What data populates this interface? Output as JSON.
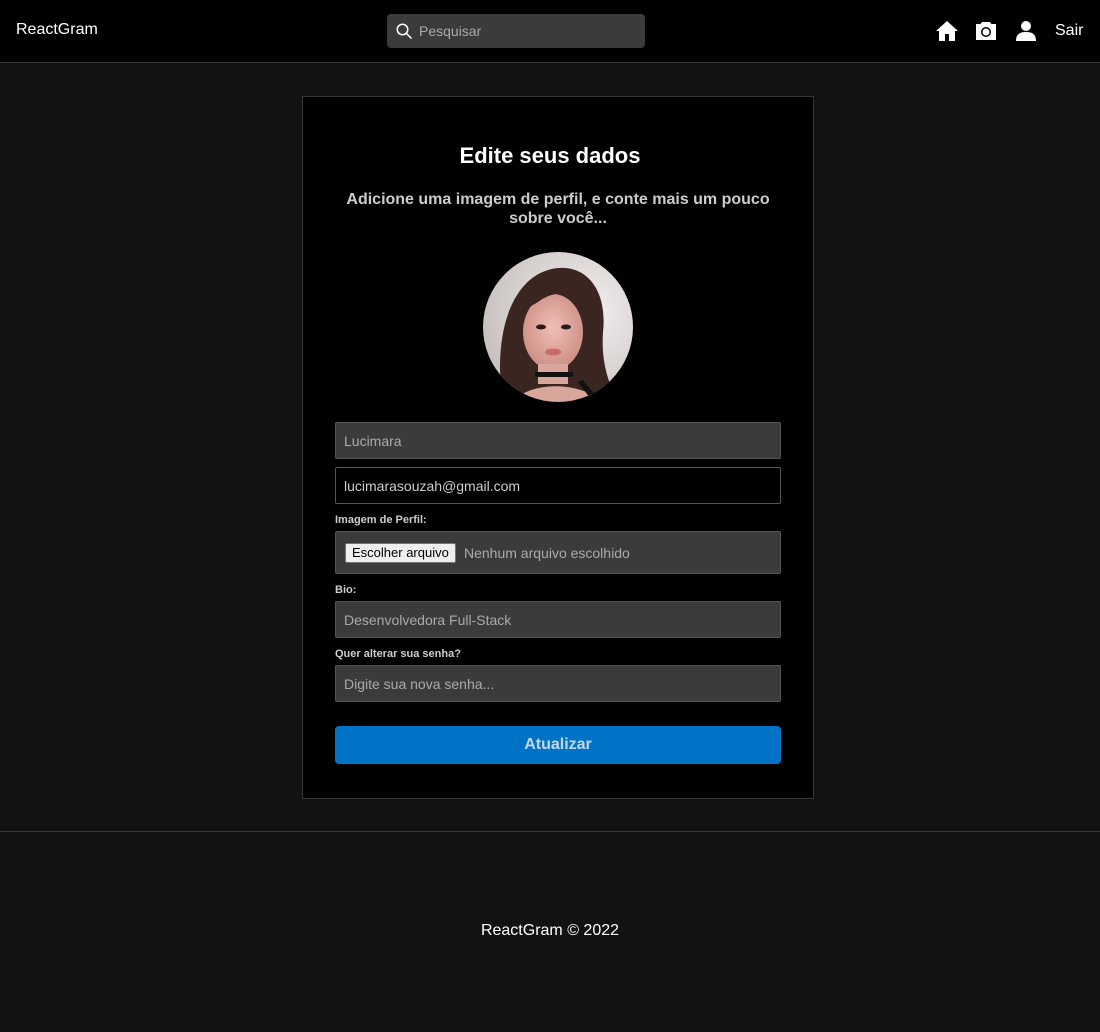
{
  "navbar": {
    "brand": "ReactGram",
    "search_placeholder": "Pesquisar",
    "icons": [
      "home-icon",
      "camera-icon",
      "user-icon"
    ],
    "logout_label": "Sair"
  },
  "form": {
    "title": "Edite seus dados",
    "subtitle": "Adicione uma imagem de perfil, e conte mais um pouco sobre você...",
    "name_value": "Lucimara",
    "email_value": "lucimarasouzah@gmail.com",
    "image_label": "Imagem de Perfil:",
    "file_button_label": "Escolher arquivo",
    "file_status": "Nenhum arquivo escolhido",
    "bio_label": "Bio:",
    "bio_value": "Desenvolvedora Full-Stack",
    "password_label": "Quer alterar sua senha?",
    "password_placeholder": "Digite sua nova senha...",
    "submit_label": "Atualizar"
  },
  "footer": {
    "text": "ReactGram © 2022"
  },
  "colors": {
    "background": "#121212",
    "surface": "#000000",
    "accent": "#0073c6"
  }
}
